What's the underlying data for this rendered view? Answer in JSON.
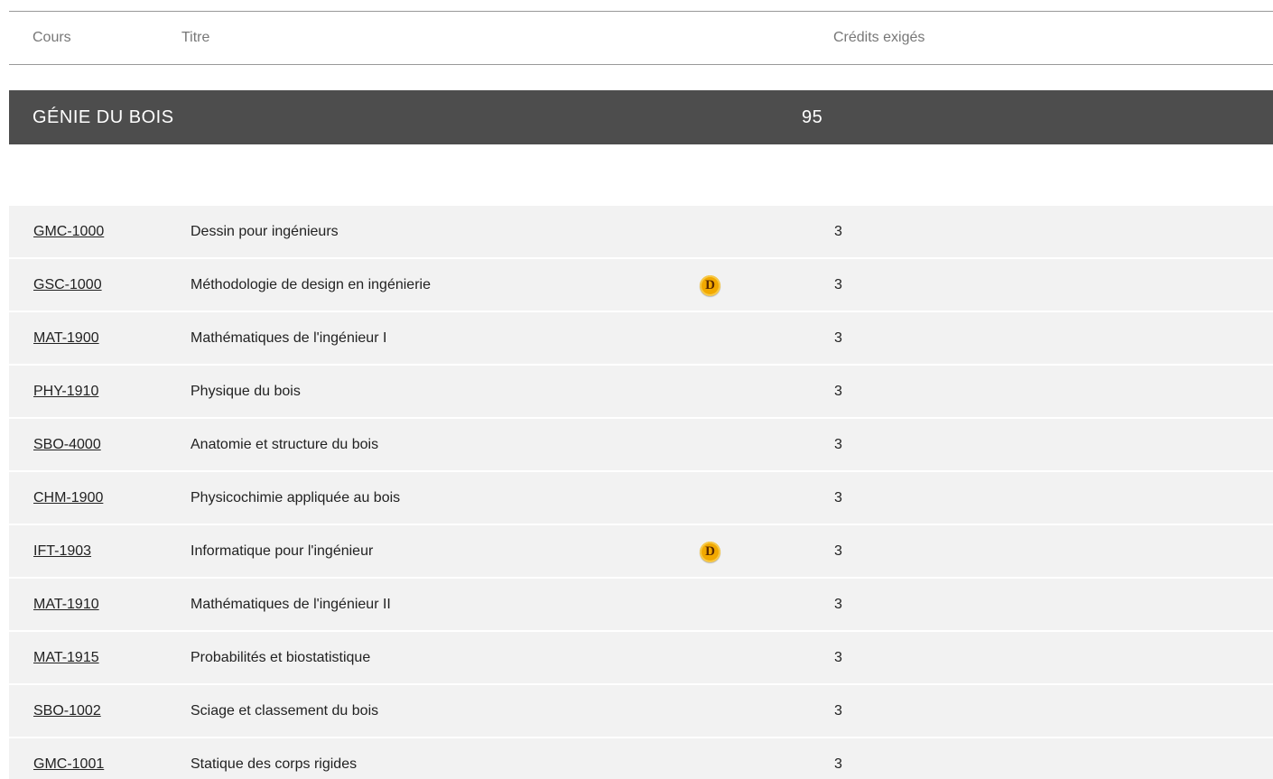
{
  "header": {
    "col_cours": "Cours",
    "col_titre": "Titre",
    "col_credits": "Crédits exigés"
  },
  "section": {
    "title": "GÉNIE DU BOIS",
    "credits": "95"
  },
  "badge_letter": "D",
  "colors": {
    "section_bg": "#4d4d4d",
    "row_bg": "#f2f2f2",
    "badge": "#f2a900"
  },
  "courses": [
    {
      "code": "GMC-1000",
      "title": "Dessin pour ingénieurs",
      "credits": "3",
      "badge": false
    },
    {
      "code": "GSC-1000",
      "title": "Méthodologie de design en ingénierie",
      "credits": "3",
      "badge": true
    },
    {
      "code": "MAT-1900",
      "title": "Mathématiques de l'ingénieur I",
      "credits": "3",
      "badge": false
    },
    {
      "code": "PHY-1910",
      "title": "Physique du bois",
      "credits": "3",
      "badge": false
    },
    {
      "code": "SBO-4000",
      "title": "Anatomie et structure du bois",
      "credits": "3",
      "badge": false
    },
    {
      "code": "CHM-1900",
      "title": "Physicochimie appliquée au bois",
      "credits": "3",
      "badge": false
    },
    {
      "code": "IFT-1903",
      "title": "Informatique pour l'ingénieur",
      "credits": "3",
      "badge": true
    },
    {
      "code": "MAT-1910",
      "title": "Mathématiques de l'ingénieur II",
      "credits": "3",
      "badge": false
    },
    {
      "code": "MAT-1915",
      "title": "Probabilités et biostatistique",
      "credits": "3",
      "badge": false
    },
    {
      "code": "SBO-1002",
      "title": "Sciage et classement du bois",
      "credits": "3",
      "badge": false
    },
    {
      "code": "GMC-1001",
      "title": "Statique des corps rigides",
      "credits": "3",
      "badge": false
    }
  ]
}
